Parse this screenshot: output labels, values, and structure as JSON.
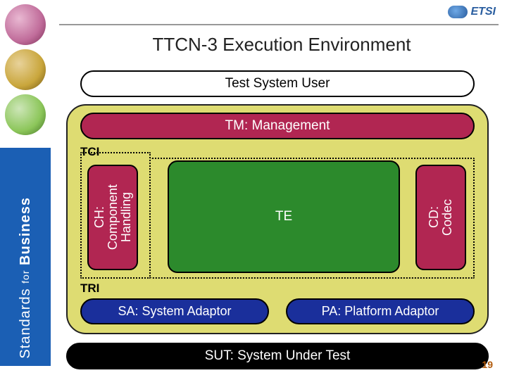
{
  "logo": {
    "text": "ETSI"
  },
  "sidebar": {
    "part1": "Standards",
    "joiner": "for",
    "part2": "Business"
  },
  "title": "TTCN-3 Execution Environment",
  "diagram": {
    "user": "Test System User",
    "tm": "TM: Management",
    "tci": "TCI",
    "ch": "CH:\nComponent\nHandling",
    "te": "TE",
    "cd": "CD:\nCodec",
    "tri": "TRI",
    "sa": "SA: System Adaptor",
    "pa": "PA: Platform Adaptor",
    "sut": "SUT: System Under Test"
  },
  "page": "19"
}
